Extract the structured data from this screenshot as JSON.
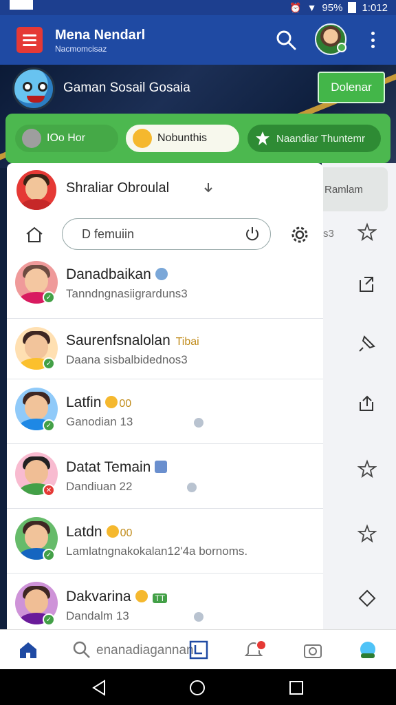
{
  "status_bar": {
    "time": "1:012",
    "battery": "95%"
  },
  "app_bar": {
    "title": "Mena Nendarl",
    "subtitle": "Nacmomcisaz",
    "icons": [
      "menu-icon",
      "search-icon",
      "profile-avatar",
      "more-vertical-icon"
    ]
  },
  "hero": {
    "title": "Gaman Sosail Gosaia",
    "button_label": "Dolenar"
  },
  "tabs": [
    {
      "label": "IOo Hor",
      "icon": "avatar-icon"
    },
    {
      "label": "Nobunthis",
      "icon": "emoji-icon"
    },
    {
      "label": "Naandiar Thuntemr",
      "icon": "star-burst-icon"
    }
  ],
  "drawer": {
    "header_name": "Shraliar Obroulal",
    "search_value": "D femuiin"
  },
  "right_panel": {
    "chip_label": "Ramlam",
    "muted_text": "s3"
  },
  "chats": [
    {
      "name": "Danadbaikan",
      "subtitle": "Tanndngnasiigrarduns3",
      "extra": "",
      "status": "online",
      "action_icon": "share-icon"
    },
    {
      "name": "Saurenfsnalolan",
      "subtitle": "Daana sisbalbidednos3",
      "extra": "Tibai",
      "status": "online",
      "action_icon": "pin-icon"
    },
    {
      "name": "Latfin",
      "subtitle": "Ganodian 13",
      "extra": "00",
      "status": "online",
      "action_icon": "upload-icon"
    },
    {
      "name": "Datat Temain",
      "subtitle": "Dandiuan 22",
      "extra": "",
      "status": "busy",
      "action_icon": "star-icon"
    },
    {
      "name": "Latdn",
      "subtitle": "Lamlatngnakokalan12'4a bornoms.",
      "extra": "00",
      "status": "online",
      "action_icon": "star-icon"
    },
    {
      "name": "Dakvarina",
      "subtitle": "Dandalm 13",
      "extra": "TT",
      "status": "online",
      "action_icon": "diamond-icon"
    }
  ],
  "bottom_nav": {
    "search_label": "enanadiagannan",
    "icons": [
      "home-icon",
      "search-icon",
      "tag-icon",
      "notification-icon",
      "camera-icon",
      "mascot-icon"
    ]
  },
  "colors": {
    "app_bar": "#1f4aa3",
    "accent_green": "#4cb84f",
    "menu_red": "#e53935"
  }
}
